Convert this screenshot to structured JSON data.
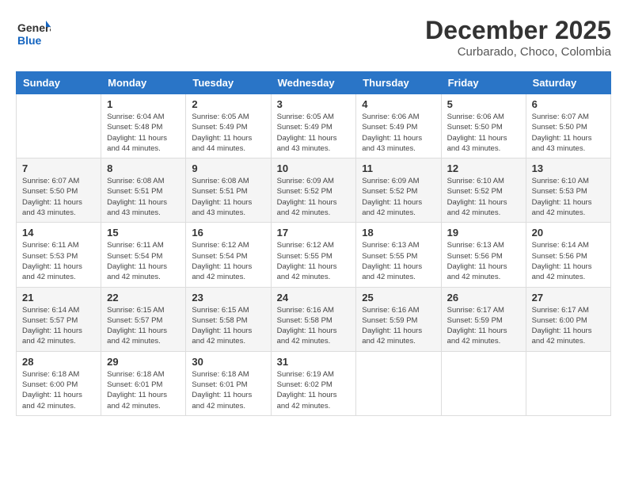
{
  "header": {
    "logo_general": "General",
    "logo_blue": "Blue",
    "month_year": "December 2025",
    "location": "Curbarado, Choco, Colombia"
  },
  "days_of_week": [
    "Sunday",
    "Monday",
    "Tuesday",
    "Wednesday",
    "Thursday",
    "Friday",
    "Saturday"
  ],
  "weeks": [
    [
      {
        "day": "",
        "info": ""
      },
      {
        "day": "1",
        "info": "Sunrise: 6:04 AM\nSunset: 5:48 PM\nDaylight: 11 hours\nand 44 minutes."
      },
      {
        "day": "2",
        "info": "Sunrise: 6:05 AM\nSunset: 5:49 PM\nDaylight: 11 hours\nand 44 minutes."
      },
      {
        "day": "3",
        "info": "Sunrise: 6:05 AM\nSunset: 5:49 PM\nDaylight: 11 hours\nand 43 minutes."
      },
      {
        "day": "4",
        "info": "Sunrise: 6:06 AM\nSunset: 5:49 PM\nDaylight: 11 hours\nand 43 minutes."
      },
      {
        "day": "5",
        "info": "Sunrise: 6:06 AM\nSunset: 5:50 PM\nDaylight: 11 hours\nand 43 minutes."
      },
      {
        "day": "6",
        "info": "Sunrise: 6:07 AM\nSunset: 5:50 PM\nDaylight: 11 hours\nand 43 minutes."
      }
    ],
    [
      {
        "day": "7",
        "info": "Sunrise: 6:07 AM\nSunset: 5:50 PM\nDaylight: 11 hours\nand 43 minutes."
      },
      {
        "day": "8",
        "info": "Sunrise: 6:08 AM\nSunset: 5:51 PM\nDaylight: 11 hours\nand 43 minutes."
      },
      {
        "day": "9",
        "info": "Sunrise: 6:08 AM\nSunset: 5:51 PM\nDaylight: 11 hours\nand 43 minutes."
      },
      {
        "day": "10",
        "info": "Sunrise: 6:09 AM\nSunset: 5:52 PM\nDaylight: 11 hours\nand 42 minutes."
      },
      {
        "day": "11",
        "info": "Sunrise: 6:09 AM\nSunset: 5:52 PM\nDaylight: 11 hours\nand 42 minutes."
      },
      {
        "day": "12",
        "info": "Sunrise: 6:10 AM\nSunset: 5:52 PM\nDaylight: 11 hours\nand 42 minutes."
      },
      {
        "day": "13",
        "info": "Sunrise: 6:10 AM\nSunset: 5:53 PM\nDaylight: 11 hours\nand 42 minutes."
      }
    ],
    [
      {
        "day": "14",
        "info": "Sunrise: 6:11 AM\nSunset: 5:53 PM\nDaylight: 11 hours\nand 42 minutes."
      },
      {
        "day": "15",
        "info": "Sunrise: 6:11 AM\nSunset: 5:54 PM\nDaylight: 11 hours\nand 42 minutes."
      },
      {
        "day": "16",
        "info": "Sunrise: 6:12 AM\nSunset: 5:54 PM\nDaylight: 11 hours\nand 42 minutes."
      },
      {
        "day": "17",
        "info": "Sunrise: 6:12 AM\nSunset: 5:55 PM\nDaylight: 11 hours\nand 42 minutes."
      },
      {
        "day": "18",
        "info": "Sunrise: 6:13 AM\nSunset: 5:55 PM\nDaylight: 11 hours\nand 42 minutes."
      },
      {
        "day": "19",
        "info": "Sunrise: 6:13 AM\nSunset: 5:56 PM\nDaylight: 11 hours\nand 42 minutes."
      },
      {
        "day": "20",
        "info": "Sunrise: 6:14 AM\nSunset: 5:56 PM\nDaylight: 11 hours\nand 42 minutes."
      }
    ],
    [
      {
        "day": "21",
        "info": "Sunrise: 6:14 AM\nSunset: 5:57 PM\nDaylight: 11 hours\nand 42 minutes."
      },
      {
        "day": "22",
        "info": "Sunrise: 6:15 AM\nSunset: 5:57 PM\nDaylight: 11 hours\nand 42 minutes."
      },
      {
        "day": "23",
        "info": "Sunrise: 6:15 AM\nSunset: 5:58 PM\nDaylight: 11 hours\nand 42 minutes."
      },
      {
        "day": "24",
        "info": "Sunrise: 6:16 AM\nSunset: 5:58 PM\nDaylight: 11 hours\nand 42 minutes."
      },
      {
        "day": "25",
        "info": "Sunrise: 6:16 AM\nSunset: 5:59 PM\nDaylight: 11 hours\nand 42 minutes."
      },
      {
        "day": "26",
        "info": "Sunrise: 6:17 AM\nSunset: 5:59 PM\nDaylight: 11 hours\nand 42 minutes."
      },
      {
        "day": "27",
        "info": "Sunrise: 6:17 AM\nSunset: 6:00 PM\nDaylight: 11 hours\nand 42 minutes."
      }
    ],
    [
      {
        "day": "28",
        "info": "Sunrise: 6:18 AM\nSunset: 6:00 PM\nDaylight: 11 hours\nand 42 minutes."
      },
      {
        "day": "29",
        "info": "Sunrise: 6:18 AM\nSunset: 6:01 PM\nDaylight: 11 hours\nand 42 minutes."
      },
      {
        "day": "30",
        "info": "Sunrise: 6:18 AM\nSunset: 6:01 PM\nDaylight: 11 hours\nand 42 minutes."
      },
      {
        "day": "31",
        "info": "Sunrise: 6:19 AM\nSunset: 6:02 PM\nDaylight: 11 hours\nand 42 minutes."
      },
      {
        "day": "",
        "info": ""
      },
      {
        "day": "",
        "info": ""
      },
      {
        "day": "",
        "info": ""
      }
    ]
  ]
}
